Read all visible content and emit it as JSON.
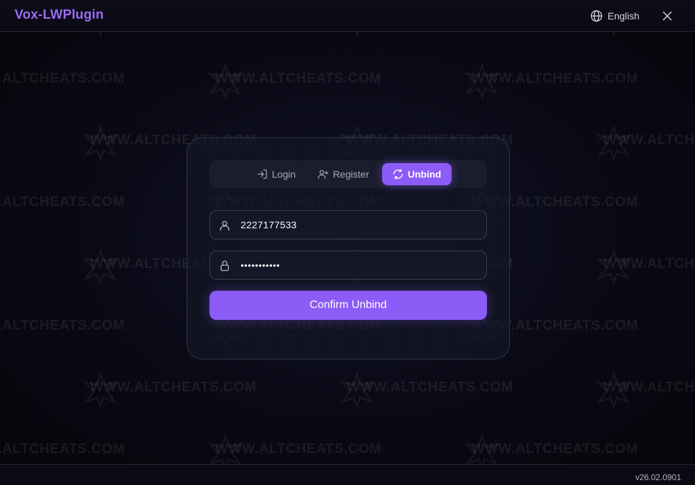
{
  "window": {
    "title": "Vox-LWPlugin",
    "language_label": "English",
    "accent_color": "#8b5cf6",
    "title_color": "#9b6cf6"
  },
  "tabs": {
    "login_label": "Login",
    "register_label": "Register",
    "unbind_label": "Unbind",
    "active": "Unbind"
  },
  "form": {
    "username_value": "2227177533",
    "password_value": "•••••••••••",
    "confirm_label": "Confirm Unbind"
  },
  "footer": {
    "version": "v26.02.0901"
  },
  "watermark": {
    "text": "WWW.ALTCHEATS.COM",
    "text_left_cut": "EATS.COM",
    "text_cut_small": "ATS.COM"
  },
  "icons": {
    "language": "globe-icon",
    "close": "close-icon",
    "login": "login-icon",
    "register": "user-plus-icon",
    "unbind": "refresh-icon",
    "username": "user-icon",
    "password": "lock-icon"
  }
}
